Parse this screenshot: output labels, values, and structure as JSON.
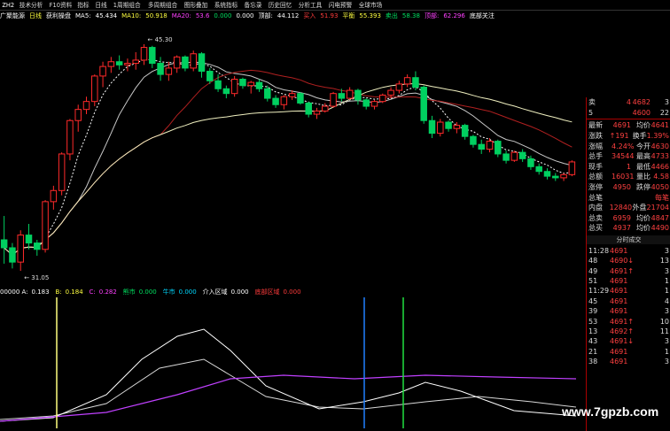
{
  "toolbar": {
    "code": "ZH2",
    "items": [
      "技术分析",
      "F10资料",
      "指标",
      "日线",
      "1周期组合",
      "多周期组合",
      "图形叠加",
      "系统指标",
      "备忘录",
      "历史回忆",
      "分析工具",
      "闪电预警",
      "全球市场"
    ]
  },
  "info": {
    "stock": "广聚能源",
    "period": "日线",
    "indicator": "获利操盘",
    "ma5_label": "MA5:",
    "ma5": "45.434",
    "ma10_label": "MA10:",
    "ma10": "50.918",
    "ma20_label": "MA20:",
    "ma20": "53.6",
    "ma30": "0.000",
    "ma60": "0.000",
    "peak_label": "顶部:",
    "peak": "44.112",
    "buy_label": "买入",
    "buy": "51.93",
    "flat_label": "平衡",
    "flat": "55.393",
    "sell_label": "卖出",
    "sell": "58.38",
    "top_label": "顶部:",
    "top": "62.296",
    "follow": "底部关注"
  },
  "chart_data": [
    {
      "type": "candlestick",
      "annotations": [
        {
          "label": "45.30"
        },
        {
          "label": "31.05"
        }
      ],
      "candles": [
        [
          33.0,
          34.5,
          31.5,
          32.5
        ],
        [
          32.5,
          32.8,
          31.2,
          31.6
        ],
        [
          31.6,
          33.6,
          31.05,
          33.3
        ],
        [
          33.3,
          34.0,
          32.4,
          32.8
        ],
        [
          32.8,
          33.0,
          32.0,
          32.4
        ],
        [
          32.4,
          35.5,
          32.2,
          35.4
        ],
        [
          35.4,
          36.4,
          34.9,
          36.1
        ],
        [
          36.1,
          38.5,
          35.8,
          38.4
        ],
        [
          38.4,
          40.6,
          38.0,
          40.5
        ],
        [
          40.5,
          41.5,
          39.8,
          41.2
        ],
        [
          41.2,
          42.0,
          40.9,
          41.7
        ],
        [
          41.7,
          43.4,
          41.4,
          43.3
        ],
        [
          43.3,
          44.2,
          42.6,
          43.9
        ],
        [
          43.9,
          44.5,
          43.5,
          44.2
        ],
        [
          44.2,
          44.6,
          43.7,
          44.0
        ],
        [
          44.0,
          44.4,
          43.6,
          44.1
        ],
        [
          44.1,
          44.8,
          43.7,
          44.3
        ],
        [
          44.3,
          45.3,
          44.0,
          45.1
        ],
        [
          45.1,
          45.2,
          43.8,
          44.1
        ],
        [
          44.1,
          44.5,
          43.0,
          43.4
        ],
        [
          43.4,
          44.2,
          43.0,
          43.8
        ],
        [
          43.8,
          44.6,
          43.5,
          44.5
        ],
        [
          44.5,
          44.6,
          43.6,
          43.8
        ],
        [
          43.8,
          44.9,
          43.6,
          44.7
        ],
        [
          44.7,
          44.8,
          43.2,
          43.6
        ],
        [
          43.6,
          43.8,
          42.8,
          43.0
        ],
        [
          43.0,
          43.4,
          42.3,
          42.5
        ],
        [
          42.5,
          42.7,
          41.9,
          42.2
        ],
        [
          42.2,
          43.3,
          42.0,
          43.1
        ],
        [
          43.1,
          43.2,
          42.5,
          42.7
        ],
        [
          42.7,
          43.0,
          42.2,
          42.9
        ],
        [
          42.9,
          43.1,
          42.3,
          42.5
        ],
        [
          42.5,
          42.7,
          41.7,
          41.9
        ],
        [
          41.9,
          42.1,
          41.3,
          41.5
        ],
        [
          41.5,
          42.1,
          41.2,
          42.0
        ],
        [
          42.0,
          42.4,
          41.8,
          42.2
        ],
        [
          42.2,
          42.3,
          41.5,
          41.6
        ],
        [
          41.6,
          41.7,
          40.7,
          40.9
        ],
        [
          40.9,
          41.3,
          40.6,
          41.1
        ],
        [
          41.1,
          41.6,
          41.0,
          41.4
        ],
        [
          41.4,
          42.3,
          41.3,
          42.2
        ],
        [
          42.2,
          42.5,
          41.7,
          41.9
        ],
        [
          41.9,
          42.6,
          41.8,
          42.4
        ],
        [
          42.4,
          42.5,
          41.5,
          41.8
        ],
        [
          41.8,
          41.9,
          41.2,
          41.4
        ],
        [
          41.4,
          41.8,
          41.2,
          41.7
        ],
        [
          41.7,
          42.2,
          41.6,
          42.1
        ],
        [
          42.1,
          42.6,
          41.9,
          42.4
        ],
        [
          42.4,
          43.0,
          42.2,
          42.8
        ],
        [
          42.8,
          43.4,
          42.6,
          43.2
        ],
        [
          43.2,
          43.6,
          42.4,
          42.6
        ],
        [
          42.6,
          42.7,
          40.3,
          40.5
        ],
        [
          40.5,
          40.8,
          39.4,
          39.7
        ],
        [
          39.7,
          40.6,
          39.5,
          40.4
        ],
        [
          40.4,
          40.5,
          39.8,
          40.0
        ],
        [
          40.0,
          40.4,
          39.7,
          40.2
        ],
        [
          40.2,
          40.3,
          39.3,
          39.5
        ],
        [
          39.5,
          39.6,
          38.8,
          39.0
        ],
        [
          39.0,
          39.3,
          38.4,
          38.7
        ],
        [
          38.7,
          39.4,
          38.5,
          39.2
        ],
        [
          39.2,
          39.3,
          38.2,
          38.4
        ],
        [
          38.4,
          38.6,
          37.8,
          38.0
        ],
        [
          38.0,
          38.6,
          37.9,
          38.5
        ],
        [
          38.5,
          38.7,
          37.9,
          38.1
        ],
        [
          38.1,
          38.3,
          37.4,
          37.6
        ],
        [
          37.6,
          37.8,
          37.1,
          37.3
        ],
        [
          37.3,
          37.5,
          36.8,
          37.0
        ],
        [
          37.0,
          37.2,
          36.7,
          36.9
        ],
        [
          36.9,
          37.2,
          36.7,
          37.1
        ],
        [
          37.1,
          38.0,
          37.0,
          37.9
        ]
      ]
    },
    {
      "type": "line",
      "series_labels": [
        "00000 A:",
        "0.183",
        "B:",
        "0.184",
        "C:",
        "0.282",
        "熊市",
        "0.000",
        "牛市",
        "0.000",
        "介入区域",
        "0.000",
        "底部区域",
        "0.000"
      ]
    }
  ],
  "quote": {
    "rows1": [
      [
        "卖",
        "4",
        "4682",
        "3"
      ],
      [
        "5",
        "",
        "4600",
        "22"
      ]
    ],
    "rows2": [
      [
        "最新",
        "4691",
        "均价",
        "4641"
      ],
      [
        "涨跌",
        "↑191",
        "换手",
        "1.39%"
      ],
      [
        "涨幅",
        "4.24%",
        "今开",
        "4630"
      ],
      [
        "总手",
        "34544",
        "最高",
        "4733"
      ],
      [
        "现手",
        "1",
        "最低",
        "4466"
      ],
      [
        "总额",
        "16031",
        "量比",
        "4.58"
      ],
      [
        "涨停",
        "4950",
        "跌停",
        "4050"
      ],
      [
        "总笔",
        "",
        "",
        "每笔"
      ],
      [
        "内盘",
        "12840",
        "外盘",
        "21704"
      ],
      [
        "总卖",
        "6959",
        "均价",
        "4847"
      ],
      [
        "总买",
        "4937",
        "均价",
        "4490"
      ]
    ],
    "ticks_title": "分时成交",
    "ticks": [
      [
        "11:28",
        "4691",
        "3"
      ],
      [
        "48",
        "4690↓",
        "13"
      ],
      [
        "49",
        "4691↑",
        "3"
      ],
      [
        "51",
        "4691",
        "1"
      ],
      [
        "11:29",
        "4691",
        "1"
      ],
      [
        "45",
        "4691",
        "4"
      ],
      [
        "39",
        "4691",
        "3"
      ],
      [
        "53",
        "4691↑",
        "10"
      ],
      [
        "13",
        "4692↑",
        "11"
      ],
      [
        "43",
        "4691↓",
        "3"
      ],
      [
        "21",
        "4691",
        "1"
      ],
      [
        "38",
        "4691",
        "3"
      ]
    ]
  },
  "watermark": "www.7gpzb.com"
}
